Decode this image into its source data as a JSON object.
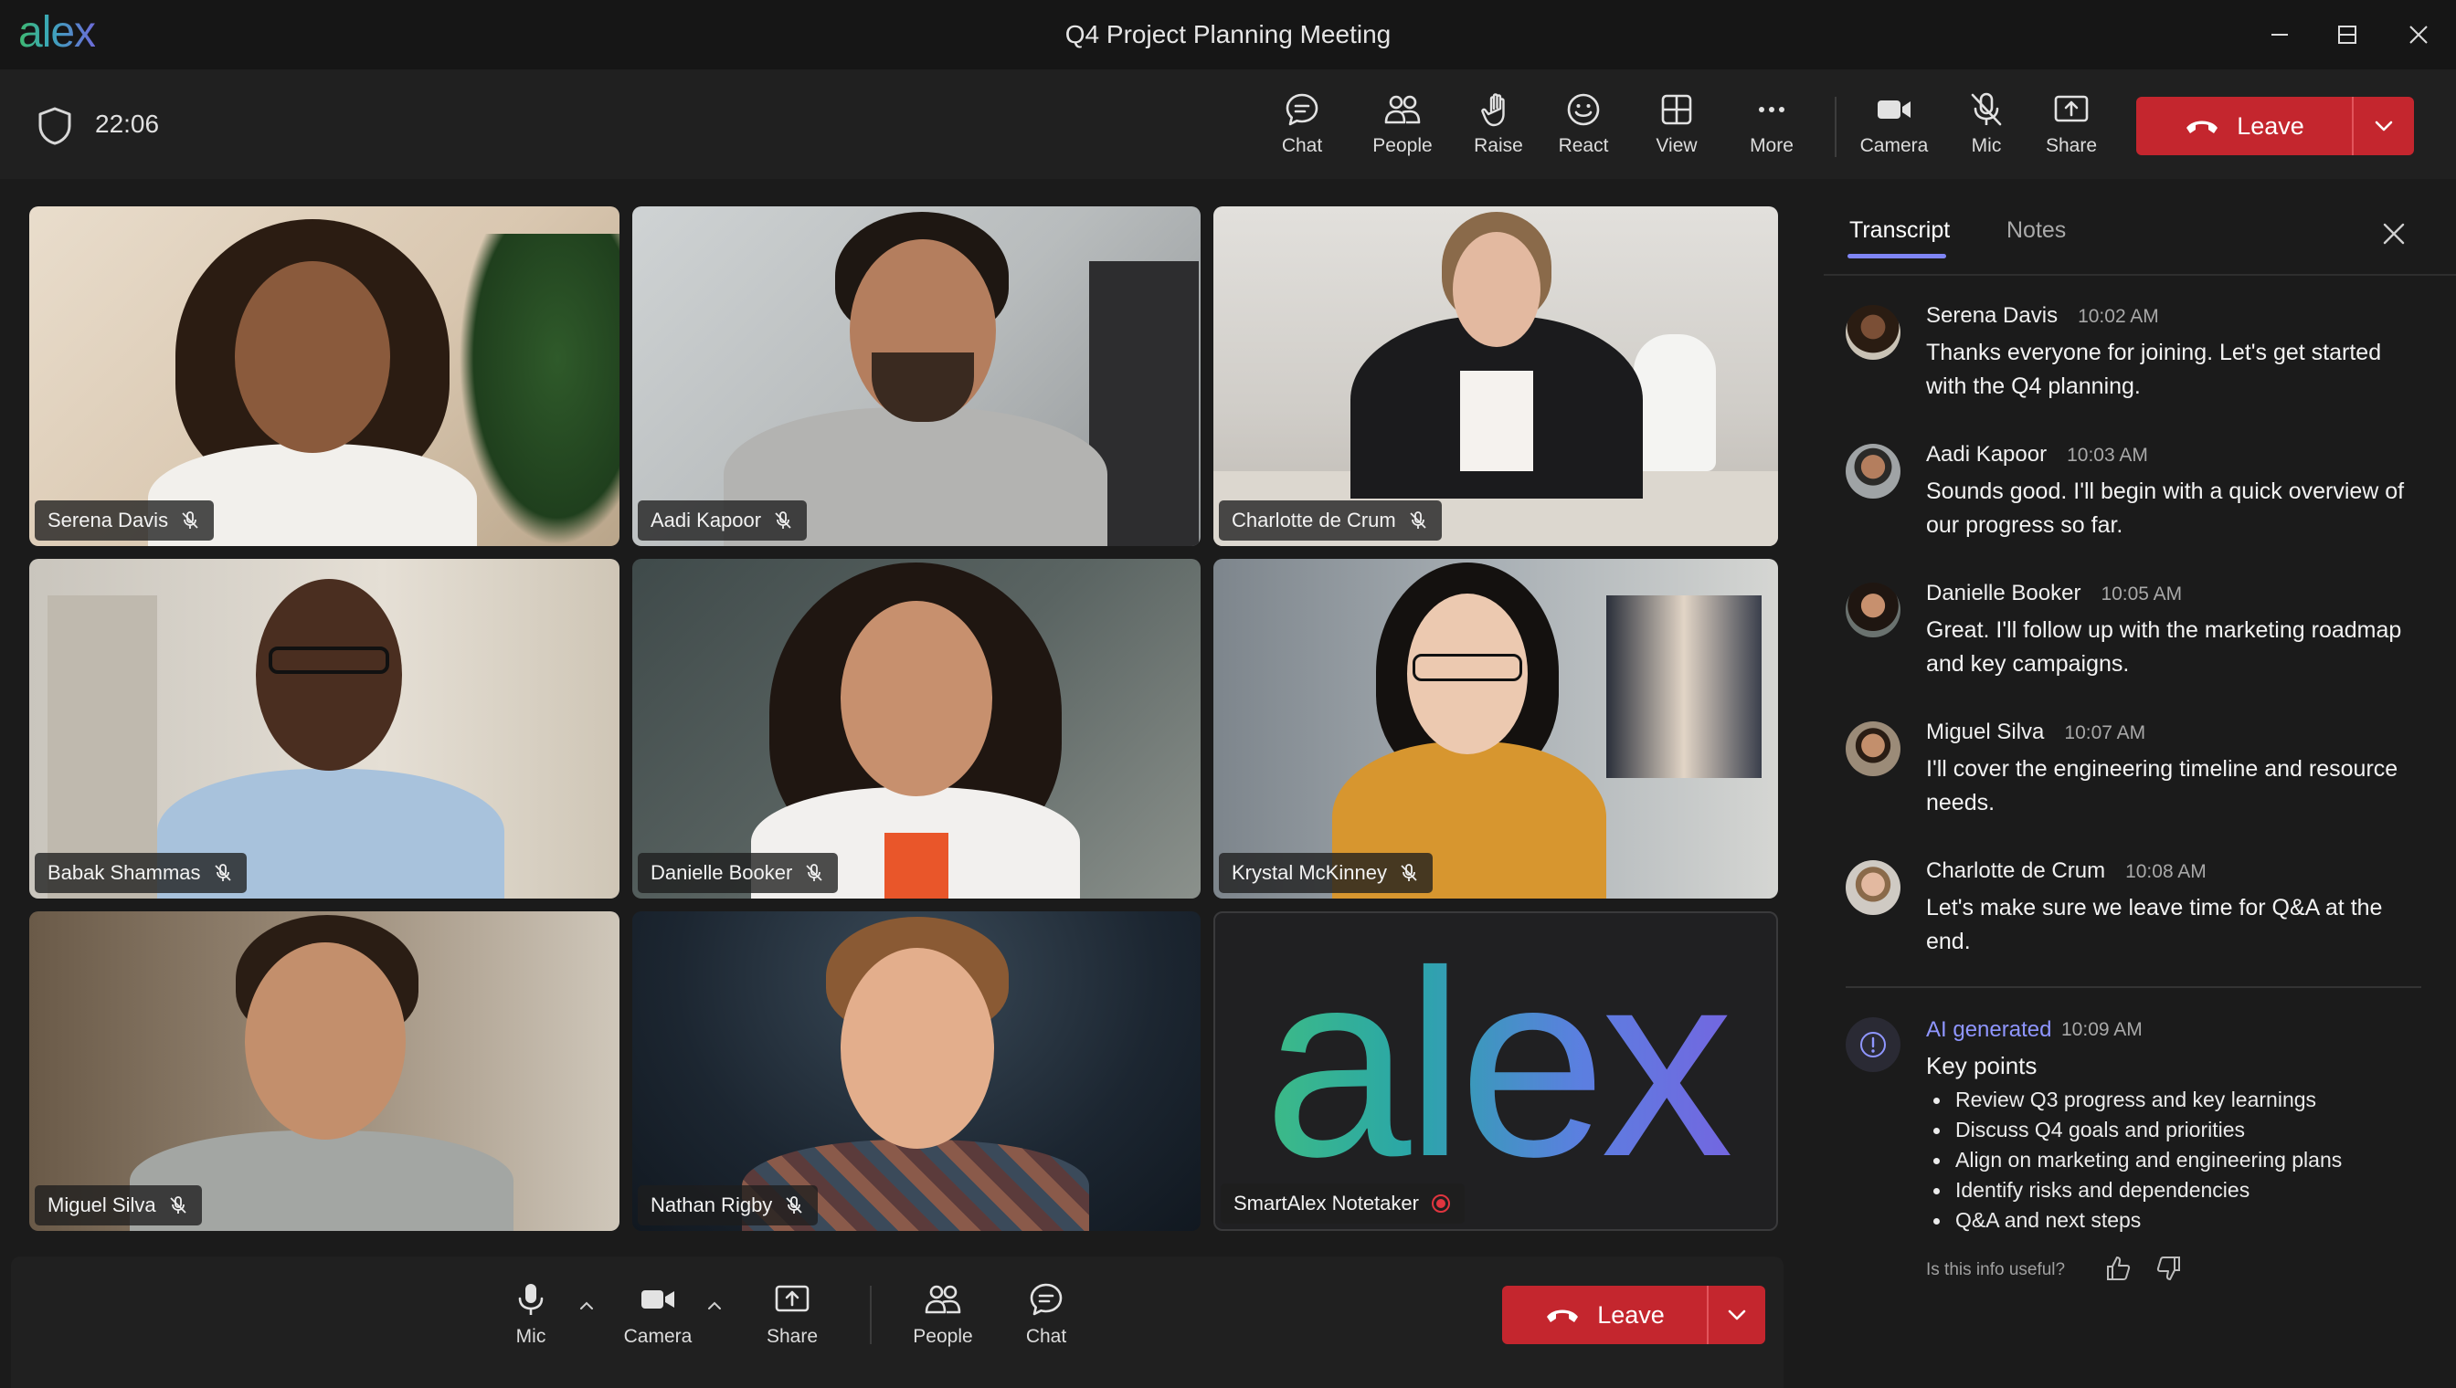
{
  "app": {
    "logo": "alex",
    "window_title": "Q4 Project Planning Meeting"
  },
  "toolbar": {
    "timer": "22:06",
    "buttons": [
      {
        "label": "Chat",
        "icon": "chat-icon"
      },
      {
        "label": "People",
        "icon": "people-icon"
      },
      {
        "label": "Raise",
        "icon": "raise-hand-icon"
      },
      {
        "label": "React",
        "icon": "react-smiley-icon"
      },
      {
        "label": "View",
        "icon": "view-grid-icon"
      },
      {
        "label": "More",
        "icon": "more-icon"
      },
      {
        "label": "Camera",
        "icon": "camera-icon"
      },
      {
        "label": "Mic",
        "icon": "mic-off-icon"
      },
      {
        "label": "Share",
        "icon": "share-icon"
      }
    ],
    "leave_label": "Leave"
  },
  "participants": [
    {
      "name": "Serena Davis",
      "muted": true
    },
    {
      "name": "Aadi Kapoor",
      "muted": true
    },
    {
      "name": "Charlotte de Crum",
      "muted": true
    },
    {
      "name": "Babak Shammas",
      "muted": true
    },
    {
      "name": "Danielle Booker",
      "muted": true
    },
    {
      "name": "Krystal McKinney",
      "muted": true
    },
    {
      "name": "Miguel Silva",
      "muted": true
    },
    {
      "name": "Nathan Rigby",
      "muted": true
    },
    {
      "name": "SmartAlex Notetaker",
      "recording": true,
      "logo": "alex"
    }
  ],
  "bottom_bar": {
    "buttons": [
      {
        "label": "Mic",
        "icon": "mic-icon"
      },
      {
        "label": "Camera",
        "icon": "camera-icon"
      },
      {
        "label": "Share",
        "icon": "share-icon"
      },
      {
        "label": "People",
        "icon": "people-icon"
      },
      {
        "label": "Chat",
        "icon": "chat-icon"
      }
    ],
    "leave_label": "Leave"
  },
  "panel": {
    "tabs": [
      "Transcript",
      "Notes"
    ],
    "active_tab": "Transcript",
    "messages": [
      {
        "name": "Serena Davis",
        "time": "10:02 AM",
        "text": "Thanks everyone for joining. Let's get started with the Q4 planning."
      },
      {
        "name": "Aadi Kapoor",
        "time": "10:03 AM",
        "text": "Sounds good. I'll begin with a quick overview of our progress so far."
      },
      {
        "name": "Danielle Booker",
        "time": "10:05 AM",
        "text": "Great. I'll follow up with the marketing roadmap and key campaigns."
      },
      {
        "name": "Miguel Silva",
        "time": "10:07 AM",
        "text": "I'll cover the engineering timeline and resource needs."
      },
      {
        "name": "Charlotte de Crum",
        "time": "10:08 AM",
        "text": "Let's make sure we leave time for Q&A at the end."
      }
    ],
    "ai": {
      "label": "AI generated",
      "time": "10:09 AM",
      "title": "Key points",
      "points": [
        "Review Q3 progress and key learnings",
        "Discuss Q4 goals and priorities",
        "Align on marketing and engineering plans",
        "Identify risks and dependencies",
        "Q&A and next steps"
      ],
      "feedback_prompt": "Is this info useful?"
    }
  },
  "colors": {
    "leave_red": "#c4262e",
    "accent": "#7f85f5",
    "recording": "#e0353f"
  }
}
